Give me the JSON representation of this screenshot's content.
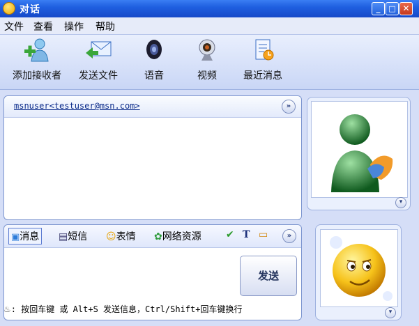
{
  "window": {
    "title": "对话",
    "minimize": "_",
    "maximize": "□",
    "close": "✕"
  },
  "menu": [
    "文件",
    "查看",
    "操作",
    "帮助"
  ],
  "toolbar": [
    {
      "label": "添加接收者",
      "icon": "add-contact-icon"
    },
    {
      "label": "发送文件",
      "icon": "send-file-icon"
    },
    {
      "label": "语音",
      "icon": "voice-icon"
    },
    {
      "label": "视频",
      "icon": "webcam-icon"
    },
    {
      "label": "最近消息",
      "icon": "recent-messages-icon"
    }
  ],
  "conversation": {
    "contact": "msnuser<testuser@msn.com>",
    "expand": "»"
  },
  "compose": {
    "tabs": [
      {
        "label": "消息",
        "icon": "message-icon"
      },
      {
        "label": "短信",
        "icon": "sms-icon"
      },
      {
        "label": "表情",
        "icon": "emoticon-icon"
      },
      {
        "label": "网络资源",
        "icon": "web-resources-icon"
      }
    ],
    "extra_icons": [
      "checkmark-icon",
      "font-icon",
      "background-icon"
    ],
    "expand": "»",
    "send": "发送",
    "hint": ": 按回车键 或 Alt+S 发送信息，Ctrl/Shift+回车键换行"
  },
  "avatar": {
    "scroll": "▾"
  }
}
